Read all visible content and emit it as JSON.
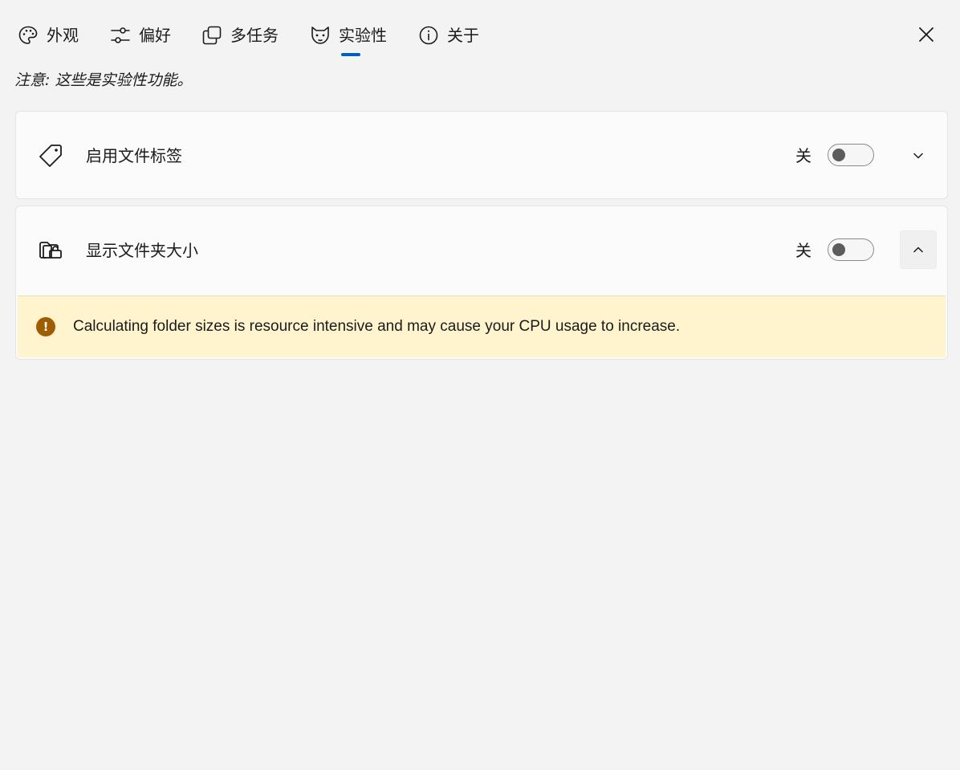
{
  "tabs": [
    {
      "label": "外观",
      "icon": "palette-icon"
    },
    {
      "label": "偏好",
      "icon": "sliders-icon"
    },
    {
      "label": "多任务",
      "icon": "multitask-windows-icon"
    },
    {
      "label": "实验性",
      "icon": "flask-icon",
      "active": true
    },
    {
      "label": "关于",
      "icon": "info-icon"
    }
  ],
  "close_icon": "close-icon",
  "note": "注意: 这些是实验性功能。",
  "settings": [
    {
      "title": "启用文件标签",
      "icon": "tag-icon",
      "state_label": "关",
      "toggle_on": false,
      "expanded": false
    },
    {
      "title": "显示文件夹大小",
      "icon": "folder-size-icon",
      "state_label": "关",
      "toggle_on": false,
      "expanded": true,
      "warning": "Calculating folder sizes is resource intensive and may cause your CPU usage to increase."
    }
  ],
  "colors": {
    "accent": "#005fb8",
    "warning_bg": "#fff4ce",
    "warning_icon": "#9d5d00"
  }
}
